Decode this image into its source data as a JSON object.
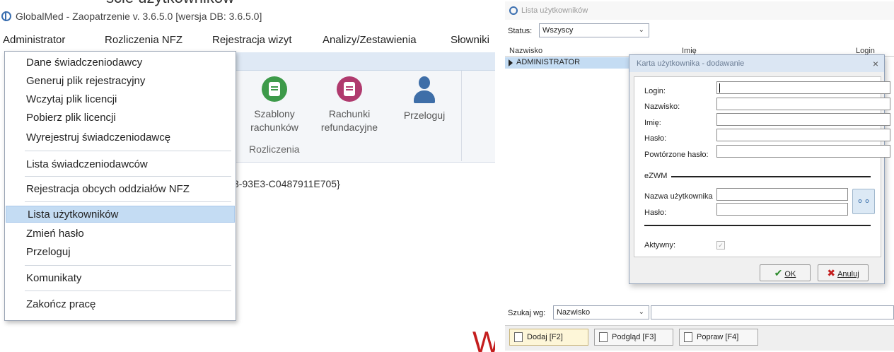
{
  "left": {
    "caption_partial": "ście użytkowników",
    "window_title": "GlobalMed - Zaopatrzenie v. 3.6.5.0 [wersja DB: 3.6.5.0]",
    "menubar": [
      "Administrator",
      "Rozliczenia NFZ",
      "Rejestracja wizyt",
      "Analizy/Zestawienia",
      "Słowniki"
    ],
    "dropdown_items": [
      "Dane świadczeniodawcy",
      "Generuj plik rejestracyjny",
      "Wczytaj plik licencji",
      "Pobierz plik licencji",
      "Wyrejestruj świadczeniodawcę",
      "Lista świadczeniodawców",
      "Rejestracja obcych oddziałów NFZ",
      "Lista użytkowników",
      "Zmień hasło",
      "Przeloguj",
      "Komunikaty",
      "Zakończ pracę"
    ],
    "selected_item": "Lista użytkowników",
    "ribbon_buttons": [
      {
        "line1": "Szablony",
        "line2": "rachunków",
        "icon": "template-icon",
        "color": "#3d9a4a"
      },
      {
        "line1": "Rachunki",
        "line2": "refundacyjne",
        "icon": "bill-icon",
        "color": "#b03a6e"
      },
      {
        "line1": "Przeloguj",
        "line2": "",
        "icon": "user-icon",
        "color": "#3e6ea8"
      }
    ],
    "ribbon_group_label": "Rozliczenia",
    "guid_text": "3-93E3-C0487911E705}",
    "red_letter": "W"
  },
  "right": {
    "window_title": "Lista użytkowników",
    "status_label": "Status:",
    "status_value": "Wszyscy",
    "grid_columns": [
      "Nazwisko",
      "Imię",
      "Login"
    ],
    "grid_rows": [
      {
        "nazwisko": "ADMINISTRATOR"
      }
    ],
    "dialog": {
      "title": "Karta użytkownika - dodawanie",
      "close": "×",
      "fields": [
        "Login:",
        "Nazwisko:",
        "Imię:",
        "Hasło:",
        "Powtórzone hasło:"
      ],
      "section": "eZWM",
      "ezwm_fields": [
        "Nazwa użytkownika",
        "Hasło:"
      ],
      "active_label": "Aktywny:",
      "active_checked": true,
      "ok_label": "OK",
      "cancel_label": "Anuluj"
    },
    "search_label": "Szukaj wg:",
    "search_by": "Nazwisko",
    "buttons": [
      "Dodaj [F2]",
      "Podgląd [F3]",
      "Popraw [F4]"
    ]
  }
}
